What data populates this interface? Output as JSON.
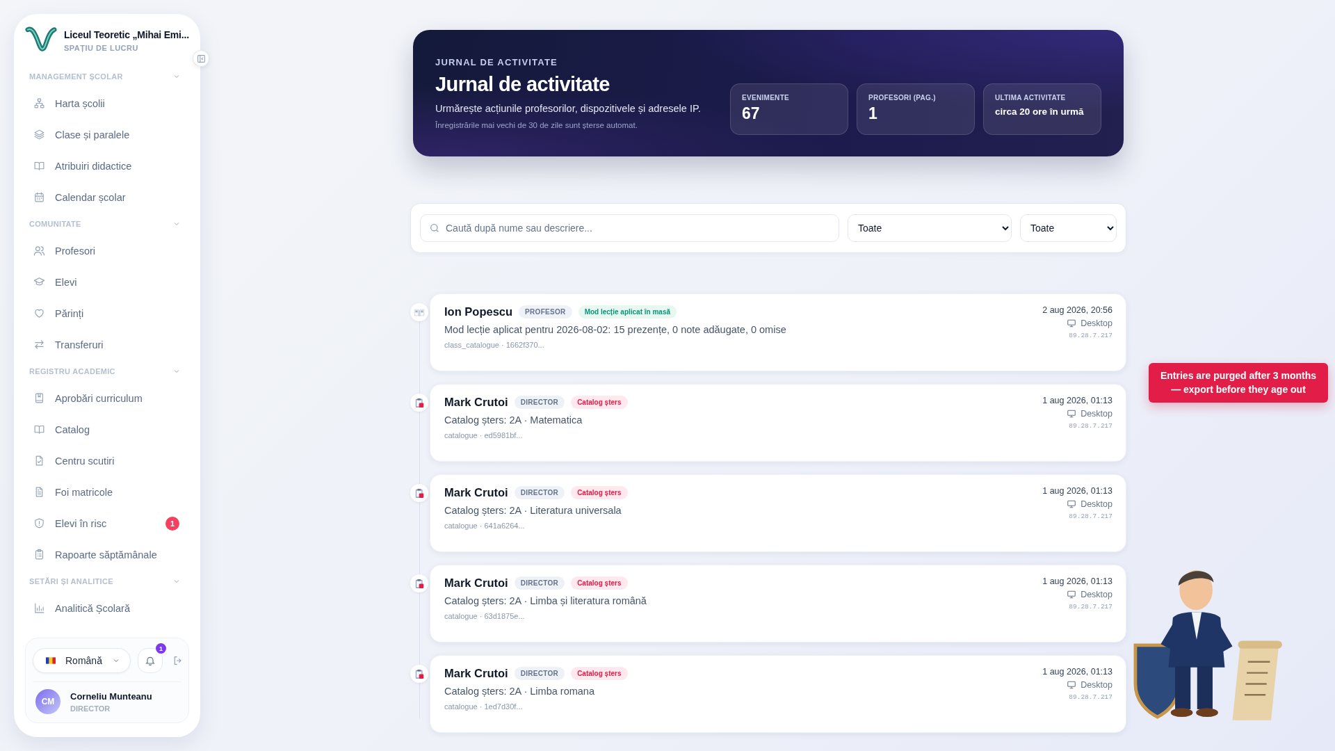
{
  "sidebar": {
    "brand": {
      "name": "Liceul Teoretic „Mihai Emi...",
      "subtitle": "SPAȚIU DE LUCRU"
    },
    "sections": [
      {
        "title": "MANAGEMENT ȘCOLAR",
        "expanded": true,
        "items": [
          {
            "label": "Harta școlii",
            "selected": false
          },
          {
            "label": "Clase și paralele",
            "selected": false
          },
          {
            "label": "Atribuiri didactice",
            "selected": false
          },
          {
            "label": "Calendar școlar",
            "selected": false
          }
        ]
      },
      {
        "title": "COMUNITATE",
        "expanded": true,
        "items": [
          {
            "label": "Profesori",
            "selected": false
          },
          {
            "label": "Elevi",
            "selected": false
          },
          {
            "label": "Părinți",
            "selected": false
          },
          {
            "label": "Transferuri",
            "selected": false
          }
        ]
      },
      {
        "title": "REGISTRU ACADEMIC",
        "expanded": true,
        "items": [
          {
            "label": "Aprobări curriculum",
            "selected": false
          },
          {
            "label": "Catalog",
            "selected": false
          },
          {
            "label": "Centru scutiri",
            "selected": false
          },
          {
            "label": "Foi matricole",
            "selected": false
          },
          {
            "label": "Elevi în risc",
            "selected": false,
            "badge": "1"
          },
          {
            "label": "Rapoarte săptămânale",
            "selected": false
          }
        ]
      },
      {
        "title": "SETĂRI ȘI ANALITICE",
        "expanded": true,
        "items": [
          {
            "label": "Analitică Școlară",
            "selected": false
          }
        ]
      }
    ],
    "footer": {
      "language": "Română",
      "notifications": "1",
      "user": {
        "initials": "CM",
        "name": "Corneliu Munteanu",
        "role": "DIRECTOR"
      }
    }
  },
  "header": {
    "eyebrow": "JURNAL DE ACTIVITATE",
    "title": "Jurnal de activitate",
    "subtitle": "Urmărește acțiunile profesorilor, dispozitivele și adresele IP.",
    "note": "Înregistrările mai vechi de 30 de zile sunt șterse automat.",
    "stats": [
      {
        "label": "EVENIMENTE",
        "value": "67",
        "kind": "big"
      },
      {
        "label": "PROFESORI (PAG.)",
        "value": "1",
        "kind": "big"
      },
      {
        "label": "ULTIMA ACTIVITATE",
        "value": "circa 20 ore în urmă",
        "kind": "small"
      }
    ]
  },
  "filters": {
    "search": {
      "placeholder": "Caută după nume sau descriere..."
    },
    "selects": [
      "Toate",
      "Toate"
    ]
  },
  "events": [
    {
      "kind": "lesson",
      "name": "Ion Popescu",
      "role": "PROFESOR",
      "tag": "Mod lecție aplicat în masă",
      "description": "Mod lecție aplicat pentru 2026-08-02: 15 prezențe, 0 note adăugate, 0 omise",
      "meta": "class_catalogue · 1662f370...",
      "time": "2 aug 2026, 20:56",
      "device": "Desktop",
      "ip": "89.28.7.217"
    },
    {
      "kind": "delete",
      "name": "Mark Crutoi",
      "role": "DIRECTOR",
      "tag": "Catalog șters",
      "description": "Catalog șters: 2A · Matematica",
      "meta": "catalogue · ed5981bf...",
      "time": "1 aug 2026, 01:13",
      "device": "Desktop",
      "ip": "89.28.7.217"
    },
    {
      "kind": "delete",
      "name": "Mark Crutoi",
      "role": "DIRECTOR",
      "tag": "Catalog șters",
      "description": "Catalog șters: 2A · Literatura universala",
      "meta": "catalogue · 641a6264...",
      "time": "1 aug 2026, 01:13",
      "device": "Desktop",
      "ip": "89.28.7.217"
    },
    {
      "kind": "delete",
      "name": "Mark Crutoi",
      "role": "DIRECTOR",
      "tag": "Catalog șters",
      "description": "Catalog șters: 2A · Limba și literatura română",
      "meta": "catalogue · 63d1875e...",
      "time": "1 aug 2026, 01:13",
      "device": "Desktop",
      "ip": "89.28.7.217"
    },
    {
      "kind": "delete",
      "name": "Mark Crutoi",
      "role": "DIRECTOR",
      "tag": "Catalog șters",
      "description": "Catalog șters: 2A · Limba romana",
      "meta": "catalogue · 1ed7d30f...",
      "time": "1 aug 2026, 01:13",
      "device": "Desktop",
      "ip": "89.28.7.217"
    }
  ],
  "tooltip": "Entries are purged after 3 months — export before they age out"
}
